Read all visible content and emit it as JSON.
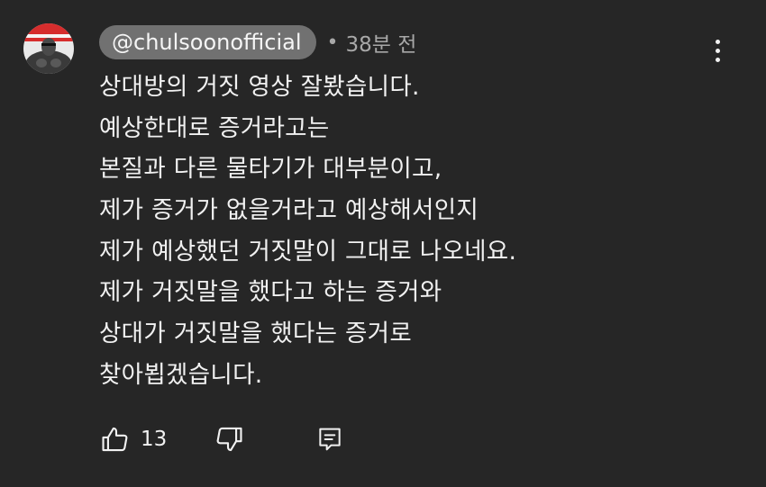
{
  "comment": {
    "author": "@chulsoonofficial",
    "separator": "•",
    "timestamp": "38분 전",
    "lines": [
      "상대방의 거짓 영상 잘봤습니다.",
      "예상한대로 증거라고는",
      "본질과 다른 물타기가 대부분이고,",
      "제가 증거가 없을거라고 예상해서인지",
      "제가 예상했던 거짓말이 그대로 나오네요.",
      "제가 거짓말을 했다고 하는 증거와",
      "상대가 거짓말을 했다는 증거로",
      "찾아뵙겠습니다."
    ],
    "like_count": "13"
  },
  "icons": {
    "menu": "more-vertical-icon",
    "like": "thumbs-up-icon",
    "dislike": "thumbs-down-icon",
    "reply": "comment-reply-icon"
  },
  "colors": {
    "background": "#262626",
    "author_chip": "#717171",
    "text": "#f1f1f1",
    "muted": "#a8a8a8"
  }
}
